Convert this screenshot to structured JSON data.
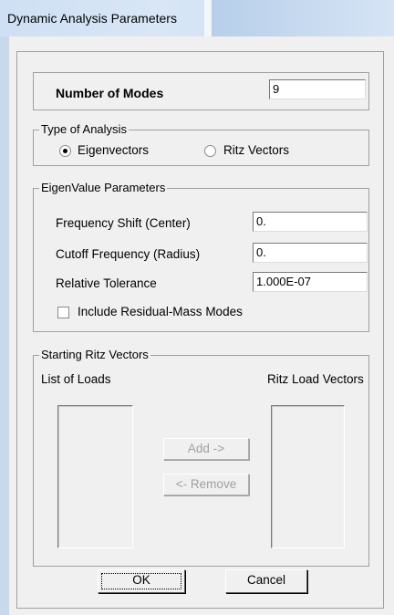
{
  "window": {
    "title": "Dynamic Analysis Parameters"
  },
  "modes": {
    "label": "Number of Modes",
    "value": "9"
  },
  "analysis_type": {
    "legend": "Type of Analysis",
    "options": [
      {
        "label": "Eigenvectors",
        "selected": true
      },
      {
        "label": "Ritz Vectors",
        "selected": false
      }
    ]
  },
  "eigen": {
    "legend": "EigenValue Parameters",
    "frequency_shift": {
      "label": "Frequency Shift  (Center)",
      "value": "0."
    },
    "cutoff_frequency": {
      "label": "Cutoff Frequency  (Radius)",
      "value": "0."
    },
    "relative_tolerance": {
      "label": "Relative Tolerance",
      "value": "1.000E-07"
    },
    "residual_mass": {
      "label": "Include Residual-Mass Modes",
      "checked": false
    }
  },
  "ritz": {
    "legend": "Starting Ritz Vectors",
    "list_of_loads_label": "List of Loads",
    "ritz_load_vectors_label": "Ritz Load Vectors",
    "add_label": "Add ->",
    "remove_label": "<- Remove"
  },
  "buttons": {
    "ok": "OK",
    "cancel": "Cancel"
  }
}
